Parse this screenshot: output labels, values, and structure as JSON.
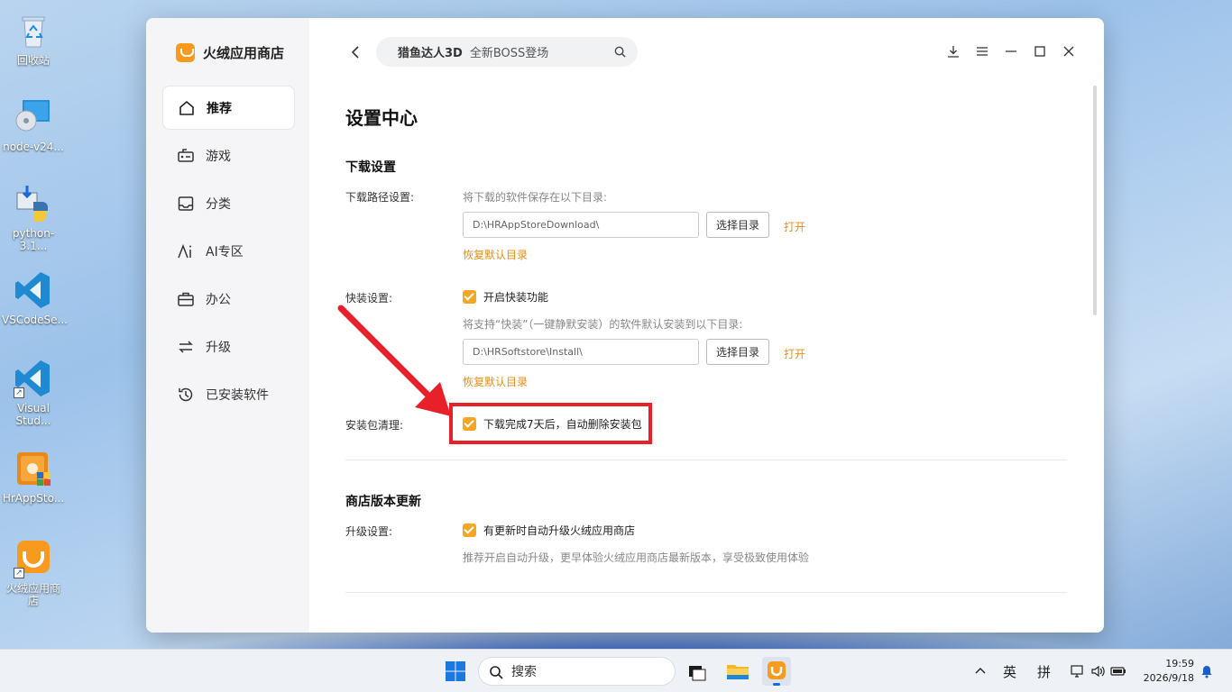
{
  "desktop": {
    "icons": [
      {
        "label": "回收站",
        "icon": "recycle-bin-icon"
      },
      {
        "label": "node-v24...",
        "icon": "node-installer-icon"
      },
      {
        "label": "python-3.1...",
        "icon": "python-installer-icon"
      },
      {
        "label": "VSCodeSe...",
        "icon": "vscode-icon"
      },
      {
        "label": "Visual Stud...",
        "icon": "vscode-icon"
      },
      {
        "label": "HrAppSto...",
        "icon": "hrappstore-installer-icon"
      },
      {
        "label": "火绒应用商店",
        "icon": "huorong-store-icon"
      }
    ]
  },
  "app": {
    "name": "火绒应用商店",
    "accent": "#f5a623",
    "nav": [
      {
        "label": "推荐",
        "icon": "home-icon"
      },
      {
        "label": "游戏",
        "icon": "gamepad-icon"
      },
      {
        "label": "分类",
        "icon": "inbox-icon"
      },
      {
        "label": "AI专区",
        "icon": "ai-icon"
      },
      {
        "label": "办公",
        "icon": "briefcase-icon"
      },
      {
        "label": "升级",
        "icon": "upgrade-icon"
      },
      {
        "label": "已安装软件",
        "icon": "history-icon"
      }
    ],
    "search": {
      "keyword": "猎鱼达人3D",
      "tagline": "全新BOSS登场"
    }
  },
  "settings": {
    "title": "设置中心",
    "download": {
      "section_title": "下载设置",
      "path_label": "下载路径设置:",
      "path_hint": "将下载的软件保存在以下目录:",
      "path_value": "D:\\HRAppStoreDownload\\",
      "choose_btn": "选择目录",
      "open_link": "打开",
      "restore_link": "恢复默认目录",
      "quick_label": "快装设置:",
      "quick_enable": "开启快装功能",
      "quick_hint": "将支持“快装”（一键静默安装）的软件默认安装到以下目录:",
      "quick_path_value": "D:\\HRSoftstore\\Install\\",
      "cleanup_label": "安装包清理:",
      "cleanup_option": "下载完成7天后，自动删除安装包"
    },
    "update": {
      "section_title": "商店版本更新",
      "upgrade_label": "升级设置:",
      "upgrade_option": "有更新时自动升级火绒应用商店",
      "upgrade_hint": "推荐开启自动升级，更早体验火绒应用商店最新版本，享受极致使用体验"
    }
  },
  "annotation": {
    "color": "#e8202a"
  },
  "taskbar": {
    "search_label": "搜索",
    "ime_lang": "英",
    "ime_mode": "拼",
    "time": "19:59",
    "date": "2026/9/18"
  }
}
